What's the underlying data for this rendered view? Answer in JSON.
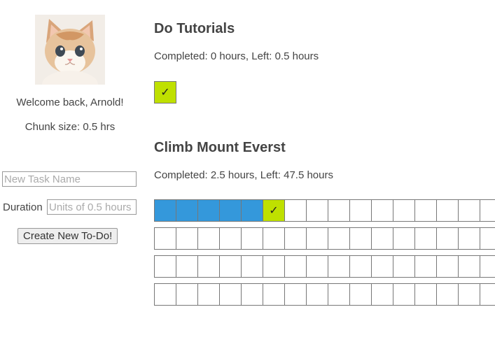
{
  "user": {
    "welcome": "Welcome back, Arnold!",
    "chunk_size": "Chunk size: 0.5 hrs"
  },
  "form": {
    "task_name_placeholder": "New Task Name",
    "duration_label": "Duration",
    "duration_placeholder": "Units of 0.5 hours",
    "create_button": "Create New To-Do!"
  },
  "tasks": [
    {
      "title": "Do Tutorials",
      "progress": "Completed: 0 hours, Left: 0.5 hours",
      "total_chunks": 1,
      "done_chunks": 0,
      "check_symbol": "✓"
    },
    {
      "title": "Climb Mount Everst",
      "progress": "Completed: 2.5 hours, Left: 47.5 hours",
      "total_chunks": 64,
      "done_chunks": 5,
      "check_symbol": "✓"
    }
  ],
  "colors": {
    "done": "#3498db",
    "current": "#bfe000"
  }
}
